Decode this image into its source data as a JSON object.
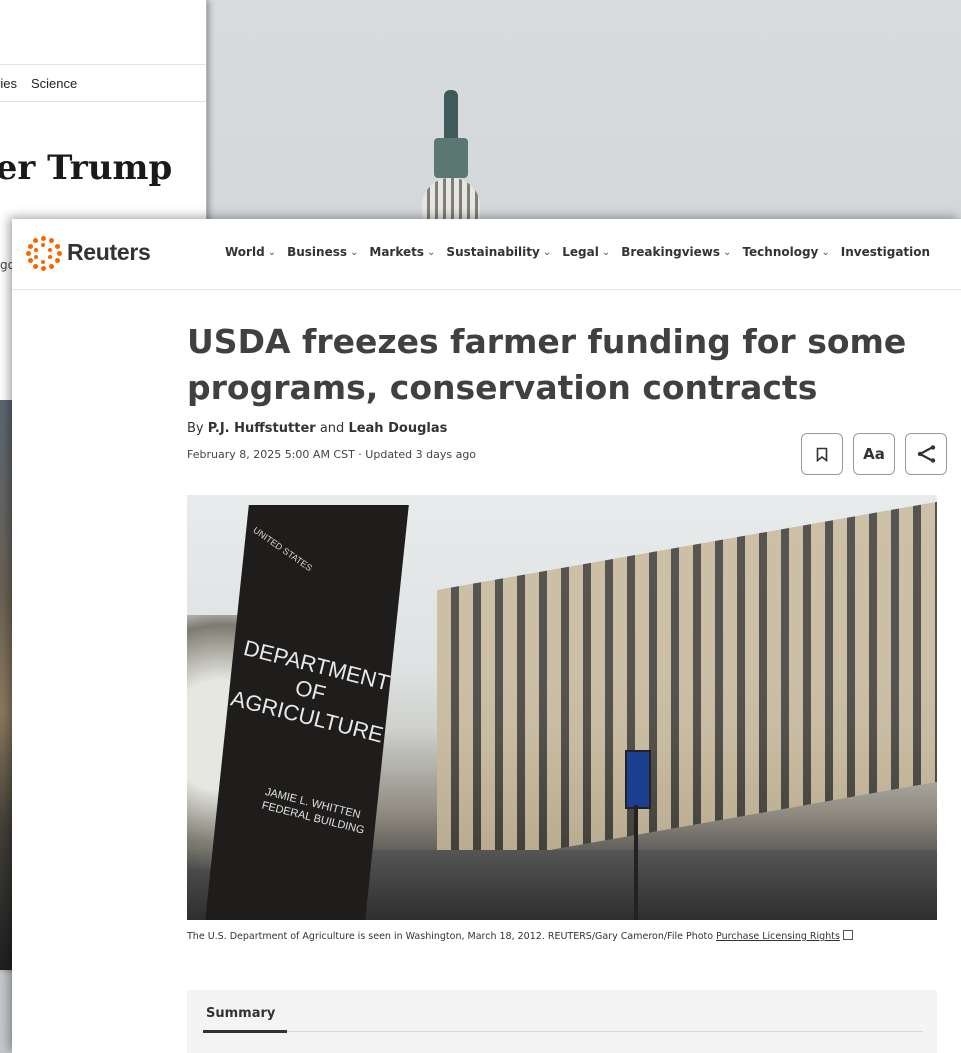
{
  "background_article": {
    "nav_items": [
      "ries",
      "Science"
    ],
    "headline_fragment": "ter Trump",
    "time_fragment": "go"
  },
  "reuters": {
    "logo_text": "Reuters",
    "nav": [
      {
        "label": "World"
      },
      {
        "label": "Business"
      },
      {
        "label": "Markets"
      },
      {
        "label": "Sustainability"
      },
      {
        "label": "Legal"
      },
      {
        "label": "Breakingviews"
      },
      {
        "label": "Technology"
      },
      {
        "label": "Investigation"
      }
    ],
    "article": {
      "headline": "USDA freezes farmer funding for some programs, conservation contracts",
      "byline_prefix": "By",
      "author1": "P.J. Huffstutter",
      "byline_and": "and",
      "author2": "Leah Douglas",
      "dateline": "February 8, 2025 5:00 AM CST · Updated 3 days ago",
      "tools": {
        "save_icon": "bookmark-icon",
        "text_size_label": "Aa",
        "share_icon": "share-icon"
      },
      "photo": {
        "sign_line1": "DEPARTMENT",
        "sign_line2": "OF",
        "sign_line3": "AGRICULTURE",
        "sign_sub1": "JAMIE L. WHITTEN",
        "sign_sub2": "FEDERAL BUILDING",
        "sign_top": "UNITED STATES"
      },
      "caption_text": "The U.S. Department of Agriculture is seen in Washington, March 18, 2012. REUTERS/Gary Cameron/File Photo",
      "caption_link": "Purchase Licensing Rights",
      "summary_tab": "Summary"
    }
  }
}
